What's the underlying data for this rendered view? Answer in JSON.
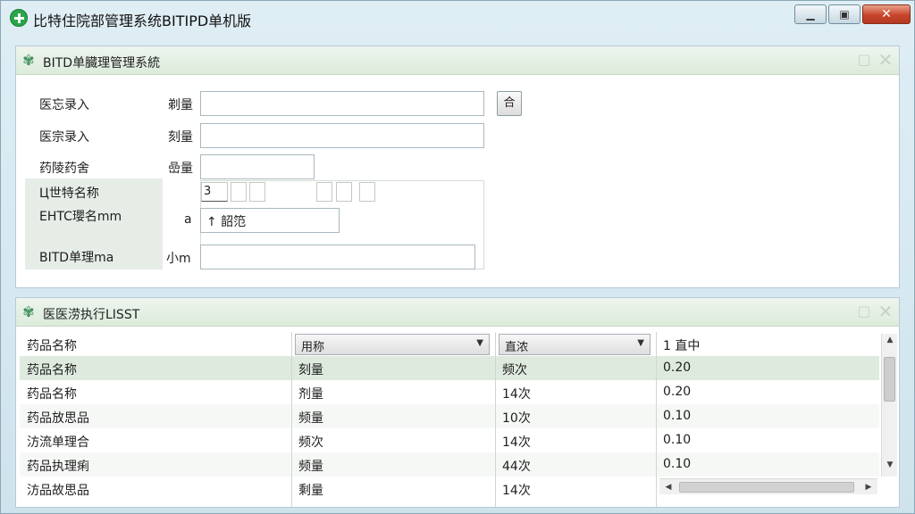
{
  "window": {
    "title": "比特住院部管理系统BITIPD单机版",
    "controls": {
      "minimize": "▁",
      "maximize": "▣",
      "close": "✕"
    }
  },
  "top_panel": {
    "title": "BITD单臓理管理系統",
    "icon": "clover-icon",
    "form": {
      "label1": "医忘录入",
      "unit1": "剃量",
      "label2": "医宗录入",
      "unit2": "刻量",
      "label3": "药陵药舍",
      "unit3": "嵒量",
      "button_small": "合",
      "grey_label1": "Ц世特名称",
      "grey_label2": "EHTC瓔名mm",
      "grey_label3": "BITD单理ma",
      "unit4": "a",
      "unit5": "小m",
      "first_box": "3",
      "select_value": "↑  韶笵"
    }
  },
  "bottom_panel": {
    "title": "医医涝执行LISST",
    "icon": "clover-icon",
    "columns": [
      "药品名称",
      "用称",
      "直浓",
      "1 直中"
    ],
    "rows": [
      [
        "药品名称",
        "刻量",
        "频次",
        "0.20"
      ],
      [
        "药品名称",
        "剂量",
        "14次",
        "0.20"
      ],
      [
        "药品放思品",
        "频量",
        "10次",
        "0.10"
      ],
      [
        "汸流单理合",
        "频次",
        "14次",
        "0.10"
      ],
      [
        "药品执理痢",
        "频量",
        "44次",
        "0.10"
      ],
      [
        "汸品故思品",
        "剩量",
        "14次",
        ""
      ]
    ]
  }
}
